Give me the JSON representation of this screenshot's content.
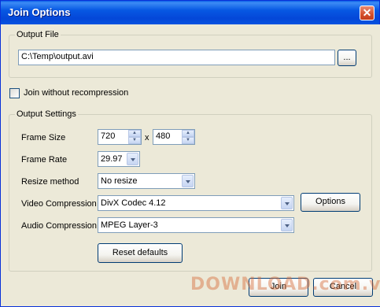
{
  "window": {
    "title": "Join Options",
    "close_glyph": "✕"
  },
  "output_file": {
    "group_label": "Output File",
    "path_value": "C:\\Temp\\output.avi",
    "browse_label": "..."
  },
  "join_without_recompression": {
    "label": "Join without recompression",
    "checked": false
  },
  "output_settings": {
    "group_label": "Output Settings",
    "frame_size": {
      "label": "Frame Size",
      "width": "720",
      "separator": "x",
      "height": "480"
    },
    "frame_rate": {
      "label": "Frame Rate",
      "value": "29.97"
    },
    "resize_method": {
      "label": "Resize method",
      "value": "No resize"
    },
    "video_compression": {
      "label": "Video Compression",
      "value": "DivX Codec 4.12",
      "options_label": "Options"
    },
    "audio_compression": {
      "label": "Audio Compression",
      "value": "MPEG Layer-3"
    },
    "reset_label": "Reset defaults"
  },
  "footer": {
    "join_label": "Join",
    "cancel_label": "Cancel"
  },
  "watermark": {
    "text": "DOWNLOAD.com.vn"
  }
}
